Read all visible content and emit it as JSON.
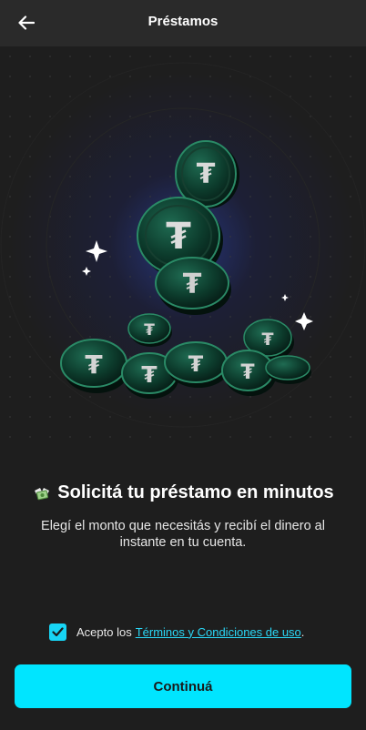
{
  "header": {
    "title": "Préstamos",
    "back_icon": "arrow-left-icon"
  },
  "hero": {
    "illustration": "tether-coins-illustration",
    "accent": "#2f4bd1",
    "coin_color": "#0c3a2a"
  },
  "content": {
    "emoji_icon": "money-with-wings-icon",
    "heading": "Solicitá tu préstamo en minutos",
    "subtitle": "Elegí el monto que necesitás y recibí el dinero al instante en tu cuenta."
  },
  "terms": {
    "checked": true,
    "prefix": "Acepto los",
    "link": "Términos y Condiciones de uso",
    "suffix": "."
  },
  "cta": {
    "label": "Continuá",
    "color": "#00e5ff"
  }
}
